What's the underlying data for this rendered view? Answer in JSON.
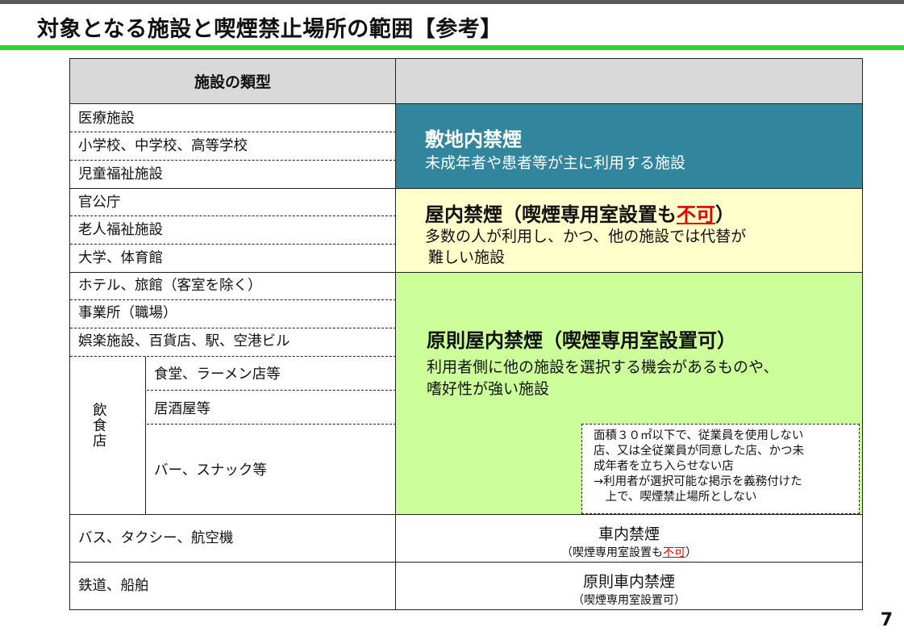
{
  "title": "対象となる施設と喫煙禁止場所の範囲【参考】",
  "page_number": "7",
  "table": {
    "header_left": "施設の類型",
    "header_right": "",
    "group1": {
      "items": [
        "医療施設",
        "小学校、中学校、高等学校",
        "児童福祉施設"
      ]
    },
    "group2": {
      "items": [
        "官公庁",
        "老人福祉施設",
        "大学、体育館"
      ]
    },
    "group3": {
      "items": [
        "ホテル、旅館（客室を除く）",
        "事業所（職場）",
        "娯楽施設、百貨店、駅、空港ビル"
      ],
      "restaurant_label": "飲食店",
      "restaurant_items": [
        "食堂、ラーメン店等",
        "居酒屋等",
        "バー、スナック等"
      ]
    },
    "zone_blue": {
      "title": "敷地内禁煙",
      "description": "未成年者や患者等が主に利用する施設"
    },
    "zone_yellow": {
      "title_prefix": "屋内禁煙（喫煙専用室設置も",
      "title_emphasis": "不可",
      "title_suffix": "）",
      "description_lines": [
        "多数の人が利用し、かつ、他の施設では代替が",
        "難しい施設"
      ]
    },
    "zone_green": {
      "title": "原則屋内禁煙（喫煙専用室設置可）",
      "description_lines": [
        "利用者側に他の施設を選択する機会があるものや、",
        "嗜好性が強い施設"
      ]
    },
    "note": {
      "lines": [
        "面積３０㎡以下で、従業員を使用しない",
        "店、又は全従業員が同意した店、かつ未",
        "成年者を立ち入らせない店",
        "→利用者が選択可能な掲示を義務付けた",
        "　上で、喫煙禁止場所としない"
      ]
    },
    "row_vehicles": {
      "label": "バス、タクシー、航空機",
      "main": "車内禁煙",
      "sub_prefix": "（喫煙専用室設置も",
      "sub_emphasis": "不可",
      "sub_suffix": "）"
    },
    "row_rail": {
      "label": "鉄道、船舶",
      "main": "原則車内禁煙",
      "sub": "（喫煙専用室設置可）"
    }
  },
  "colors": {
    "header_gray": "#d9d9d9",
    "zone_blue": "#31859c",
    "zone_yellow": "#ffffcc",
    "zone_green": "#ccff99",
    "title_underline": "#2bd42b",
    "emphasis_red": "#e00000"
  }
}
